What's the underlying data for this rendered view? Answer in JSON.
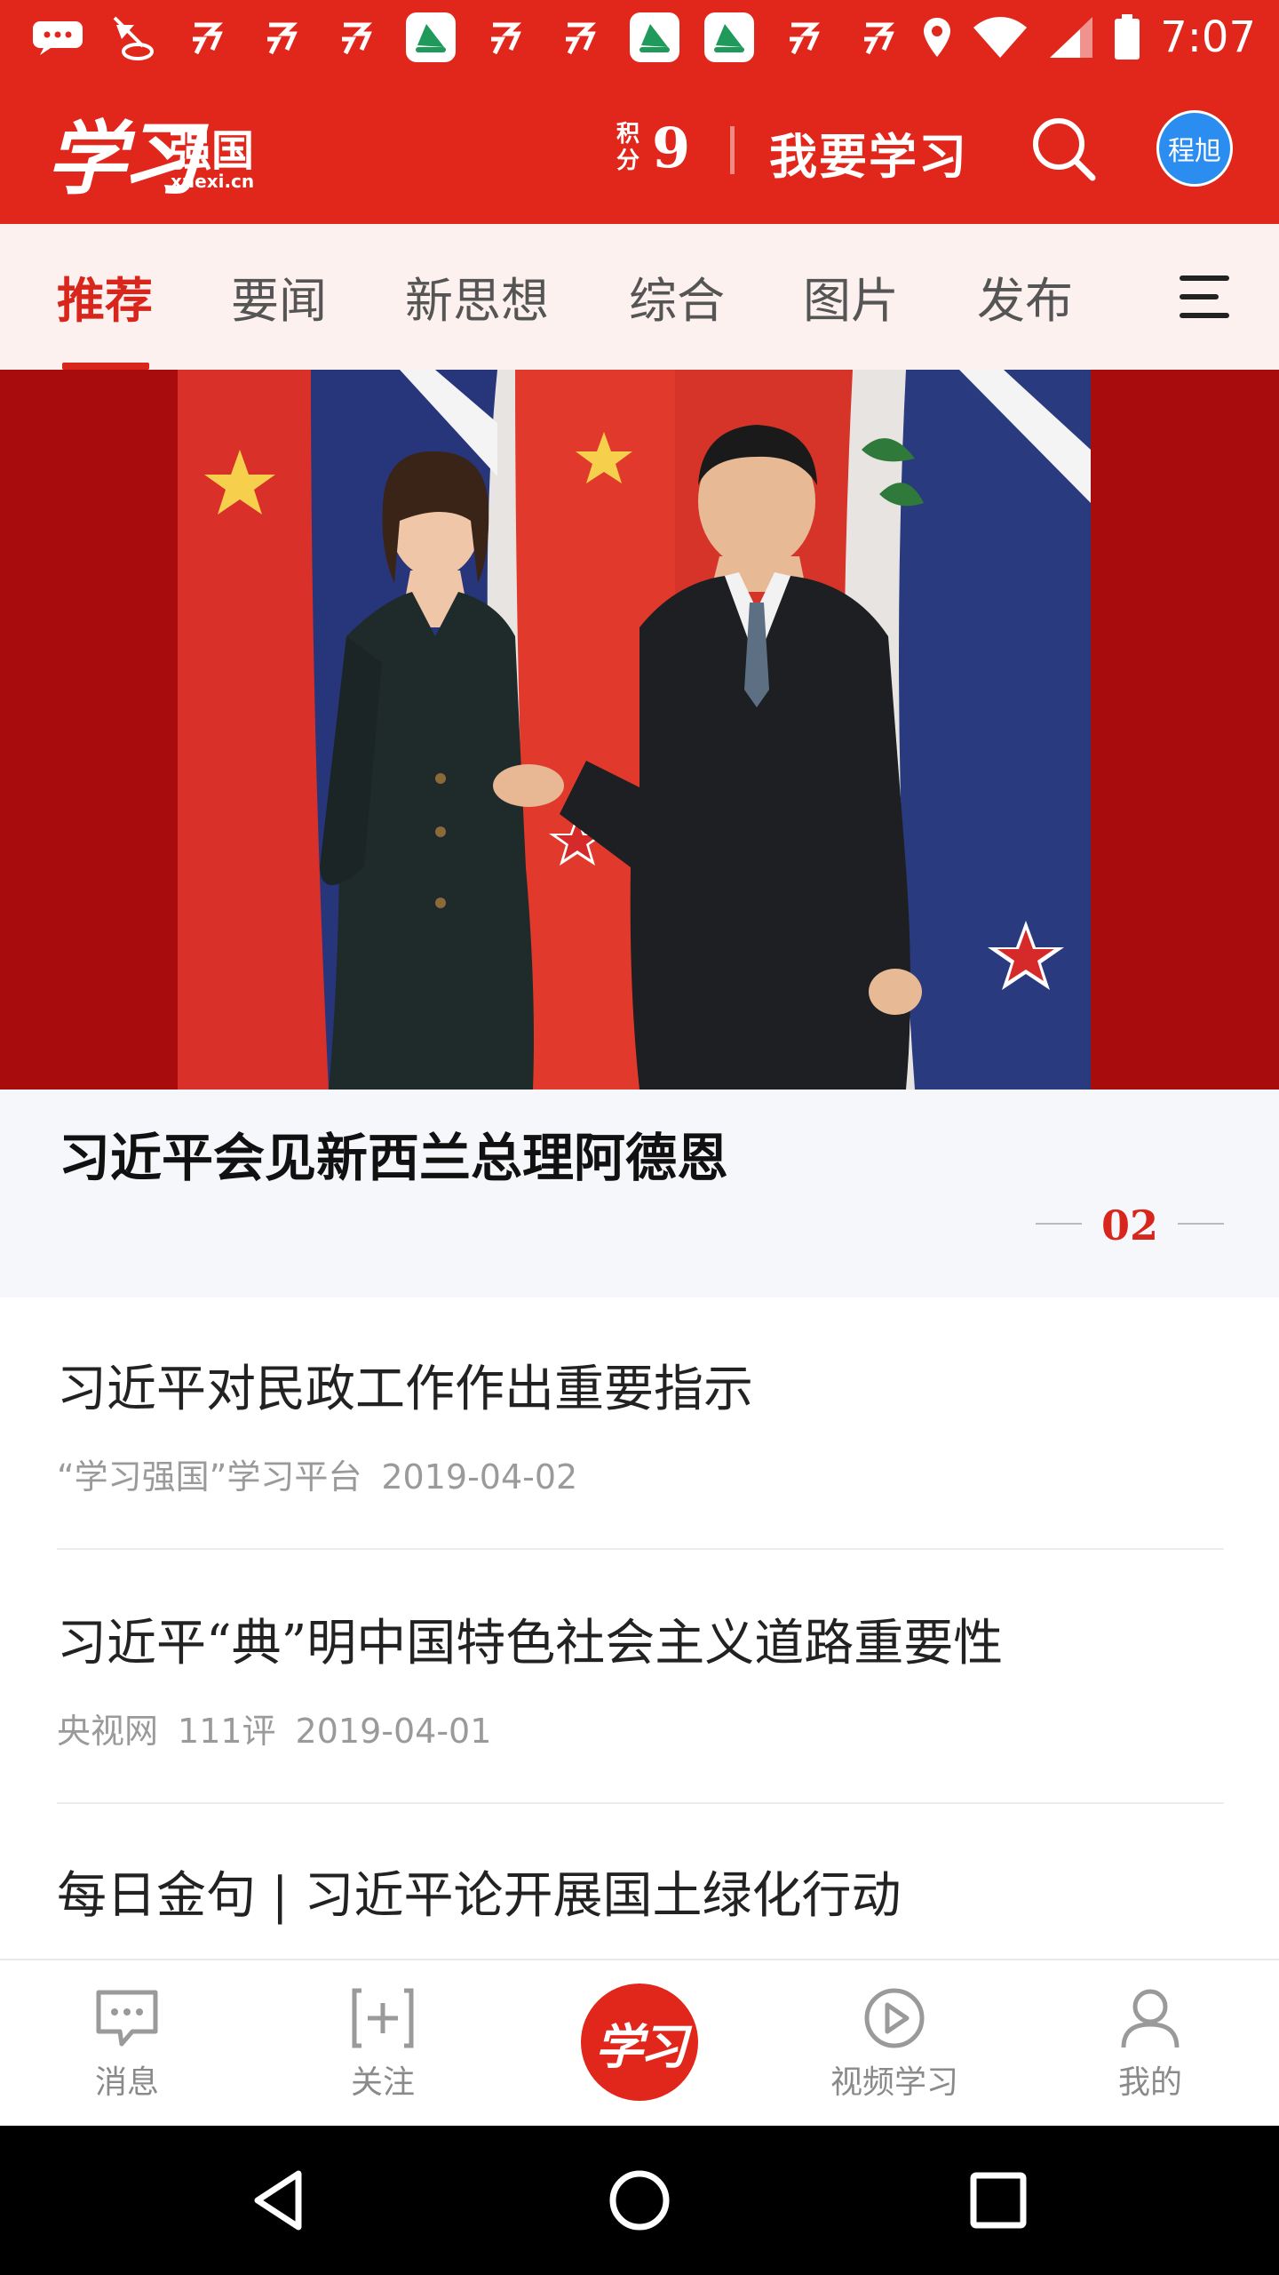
{
  "status_bar": {
    "time": "7:07",
    "notification_icons": [
      "chat-bubble-icon",
      "sailboat-icon",
      "app-badge-icon",
      "app-badge-icon",
      "app-badge-icon",
      "green-app-icon",
      "app-badge-icon",
      "app-badge-icon",
      "green-app-icon",
      "green-app-icon",
      "app-badge-icon",
      "app-badge-icon"
    ],
    "system_icons": [
      "location-icon",
      "wifi-icon",
      "cell-signal-icon",
      "battery-icon"
    ]
  },
  "header": {
    "logo_script": "学习",
    "logo_name": "强国",
    "logo_url": "xuexi.cn",
    "points_label": "积分",
    "points_value": "9",
    "study_label": "我要学习",
    "avatar_text": "程旭"
  },
  "tabs": [
    {
      "label": "推荐",
      "active": true
    },
    {
      "label": "要闻",
      "active": false
    },
    {
      "label": "新思想",
      "active": false
    },
    {
      "label": "综合",
      "active": false
    },
    {
      "label": "图片",
      "active": false
    },
    {
      "label": "发布",
      "active": false
    }
  ],
  "hero": {
    "title": "习近平会见新西兰总理阿德恩",
    "index": "02"
  },
  "news": [
    {
      "title": "习近平对民政工作作出重要指示",
      "source": "“学习强国”学习平台",
      "comments": "",
      "date": "2019-04-02"
    },
    {
      "title": "习近平“典”明中国特色社会主义道路重要性",
      "source": "央视网",
      "comments": "111评",
      "date": "2019-04-01"
    },
    {
      "title": "每日金句 | 习近平论开展国土绿化行动",
      "source": "",
      "comments": "",
      "date": ""
    }
  ],
  "bottom_nav": {
    "messages": "消息",
    "follow": "关注",
    "center": "学习",
    "video": "视频学习",
    "mine": "我的"
  },
  "colors": {
    "brand_red": "#e1261c",
    "active_tab": "#d8261c",
    "tab_bar_bg": "#fdf1ef",
    "avatar_blue": "#2c8df0"
  }
}
